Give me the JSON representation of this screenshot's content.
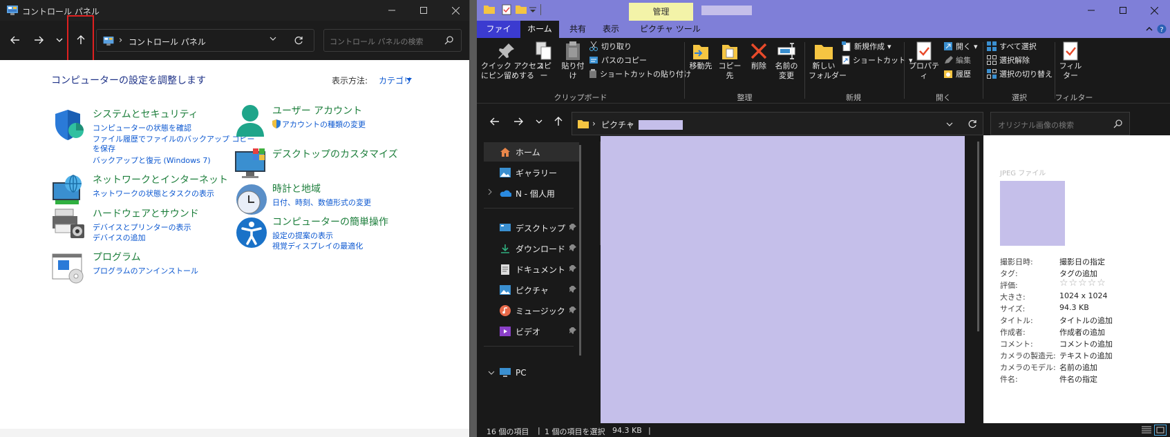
{
  "control_panel": {
    "title": "コントロール パネル",
    "address_crumb": "コントロール パネル",
    "address_chevron": "›",
    "search_placeholder": "コントロール パネルの検索",
    "heading": "コンピューターの設定を調整します",
    "view_by_label": "表示方法:",
    "view_by_value": "カテゴリ",
    "categories": [
      {
        "title": "システムとセキュリティ",
        "links": [
          "コンピューターの状態を確認",
          "ファイル履歴でファイルのバックアップ コピー",
          "を保存",
          "バックアップと復元 (Windows 7)"
        ]
      },
      {
        "title": "ネットワークとインターネット",
        "links": [
          "ネットワークの状態とタスクの表示"
        ]
      },
      {
        "title": "ハードウェアとサウンド",
        "links": [
          "デバイスとプリンターの表示",
          "デバイスの追加"
        ]
      },
      {
        "title": "プログラム",
        "links": [
          "プログラムのアンインストール"
        ]
      },
      {
        "title": "ユーザー アカウント",
        "links": [
          "アカウントの種類の変更"
        ]
      },
      {
        "title": "デスクトップのカスタマイズ",
        "links": []
      },
      {
        "title": "時計と地域",
        "links": [
          "日付、時刻、数値形式の変更"
        ]
      },
      {
        "title": "コンピューターの簡単操作",
        "links": [
          "設定の提案の表示",
          "視覚ディスプレイの最適化"
        ]
      }
    ]
  },
  "explorer": {
    "context_tab": "管理",
    "tabs": [
      "ファイル",
      "ホーム",
      "共有",
      "表示",
      "ピクチャ ツール"
    ],
    "active_tab": "ホーム",
    "ribbon": {
      "pin": "クイック アクセス\nにピン留めする",
      "copy": "コピー",
      "paste": "貼り付け",
      "cut": "切り取り",
      "copy_path": "パスのコピー",
      "paste_shortcut": "ショートカットの貼り付け",
      "group_clipboard": "クリップボード",
      "move_to": "移動先",
      "copy_to": "コピー先",
      "delete": "削除",
      "rename": "名前の\n変更",
      "group_organize": "整理",
      "new_folder": "新しい\nフォルダー",
      "new_item": "新規作成",
      "shortcut": "ショートカット",
      "group_new": "新規",
      "properties": "プロパティ",
      "open": "開く",
      "edit": "編集",
      "history": "履歴",
      "group_open": "開く",
      "select_all": "すべて選択",
      "select_none": "選択解除",
      "invert_selection": "選択の切り替え",
      "group_select": "選択",
      "filter": "フィル\nター",
      "group_filter": "フィルター"
    },
    "address": {
      "crumb1": "ピクチャ",
      "chevron": "›"
    },
    "search_placeholder": "オリジナル画像の検索",
    "nav_items": [
      {
        "label": "ホーム",
        "icon": "home-icon",
        "pinned": false
      },
      {
        "label": "ギャラリー",
        "icon": "gallery-icon",
        "pinned": false
      },
      {
        "label": "N - 個人用",
        "icon": "onedrive-icon",
        "pinned": false
      },
      {
        "label": "デスクトップ",
        "icon": "desktop-icon",
        "pinned": true
      },
      {
        "label": "ダウンロード",
        "icon": "download-icon",
        "pinned": true
      },
      {
        "label": "ドキュメント",
        "icon": "document-icon",
        "pinned": true
      },
      {
        "label": "ピクチャ",
        "icon": "pictures-icon",
        "pinned": true
      },
      {
        "label": "ミュージック",
        "icon": "music-icon",
        "pinned": true
      },
      {
        "label": "ビデオ",
        "icon": "video-icon",
        "pinned": true
      },
      {
        "label": "PC",
        "icon": "pc-icon",
        "pinned": false
      }
    ],
    "preview": {
      "file_type": "JPEG ファイル",
      "props": [
        {
          "k": "撮影日時:",
          "v": "撮影日の指定"
        },
        {
          "k": "タグ:",
          "v": "タグの追加"
        },
        {
          "k": "評価:",
          "v": "☆☆☆☆☆"
        },
        {
          "k": "大きさ:",
          "v": "1024 x 1024"
        },
        {
          "k": "サイズ:",
          "v": "94.3 KB"
        },
        {
          "k": "タイトル:",
          "v": "タイトルの追加"
        },
        {
          "k": "作成者:",
          "v": "作成者の追加"
        },
        {
          "k": "コメント:",
          "v": "コメントの追加"
        },
        {
          "k": "カメラの製造元:",
          "v": "テキストの追加"
        },
        {
          "k": "カメラのモデル:",
          "v": "名前の追加"
        },
        {
          "k": "件名:",
          "v": "件名の指定"
        }
      ]
    },
    "status": {
      "count": "16 個の項目",
      "selected": "1 個の項目を選択",
      "size": "94.3 KB",
      "sep": "|"
    }
  },
  "colors": {
    "accent": "#7f7fd8",
    "redact": "#c5bfea",
    "highlight": "#e02020",
    "link": "#0b57d0",
    "category": "#1c7e3b"
  }
}
